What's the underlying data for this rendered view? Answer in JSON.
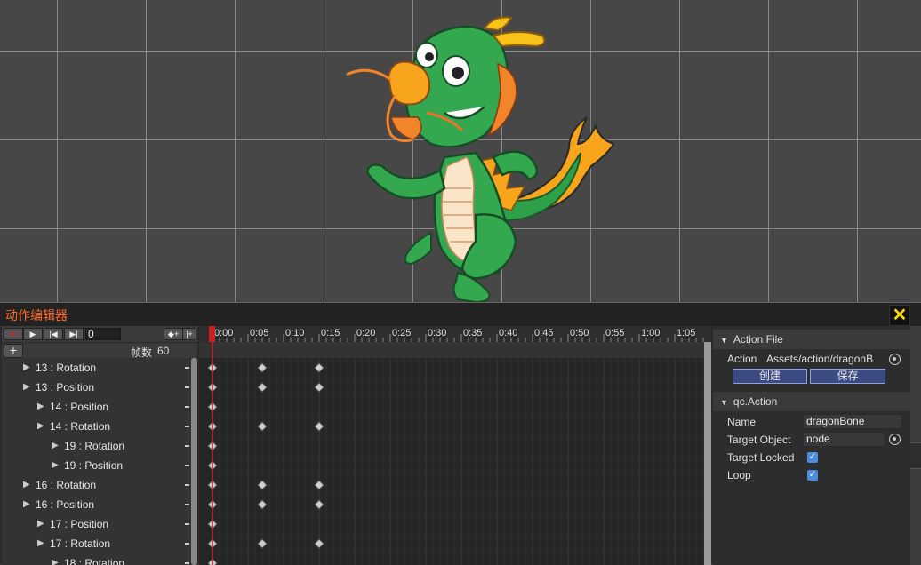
{
  "editor": {
    "title": "动作编辑器",
    "close_label": "✕"
  },
  "controls": {
    "record_icon": "record-icon",
    "play_icon": "play-icon",
    "prev_icon": "prev-frame-icon",
    "next_icon": "next-frame-icon",
    "current_frame": "0",
    "add_key_icon": "add-keyframe-icon",
    "add_event_icon": "add-event-icon",
    "add_label": "+",
    "fps_label": "帧数",
    "fps_value": "60"
  },
  "timeline": {
    "ticks": [
      "0:00",
      "0:05",
      "0:10",
      "0:15",
      "0:20",
      "0:25",
      "0:30",
      "0:35",
      "0:40",
      "0:45",
      "0:50",
      "0:55",
      "1:00",
      "1:05"
    ],
    "playhead_frame": 0
  },
  "properties": [
    {
      "label": "13 : Rotation",
      "indent": 0,
      "keys": [
        0,
        7,
        15
      ]
    },
    {
      "label": "13 : Position",
      "indent": 0,
      "keys": [
        0,
        7,
        15
      ]
    },
    {
      "label": "14 : Position",
      "indent": 1,
      "keys": [
        0
      ]
    },
    {
      "label": "14 : Rotation",
      "indent": 1,
      "keys": [
        0,
        7,
        15
      ]
    },
    {
      "label": "19 : Rotation",
      "indent": 2,
      "keys": [
        0
      ]
    },
    {
      "label": "19 : Position",
      "indent": 2,
      "keys": [
        0
      ]
    },
    {
      "label": "16 : Rotation",
      "indent": 0,
      "keys": [
        0,
        7,
        15
      ]
    },
    {
      "label": "16 : Position",
      "indent": 0,
      "keys": [
        0,
        7,
        15
      ]
    },
    {
      "label": "17 : Position",
      "indent": 1,
      "keys": [
        0
      ]
    },
    {
      "label": "17 : Rotation",
      "indent": 1,
      "keys": [
        0,
        7,
        15
      ]
    },
    {
      "label": "18 : Rotation",
      "indent": 2,
      "keys": [
        0
      ]
    }
  ],
  "inspector": {
    "action_file": {
      "header": "Action File",
      "action_label": "Action",
      "action_value": "Assets/action/dragonB",
      "create_label": "创建",
      "save_label": "保存"
    },
    "qc_action": {
      "header": "qc.Action",
      "name_label": "Name",
      "name_value": "dragonBone",
      "target_label": "Target Object",
      "target_value": "node",
      "locked_label": "Target Locked",
      "locked": true,
      "loop_label": "Loop",
      "loop": true
    }
  },
  "colors": {
    "title": "#ff6b2a",
    "close": "#ffd400",
    "playhead": "#cc1f1f",
    "button_accent": "#3b4a80",
    "checkbox": "#4b8ee0"
  }
}
